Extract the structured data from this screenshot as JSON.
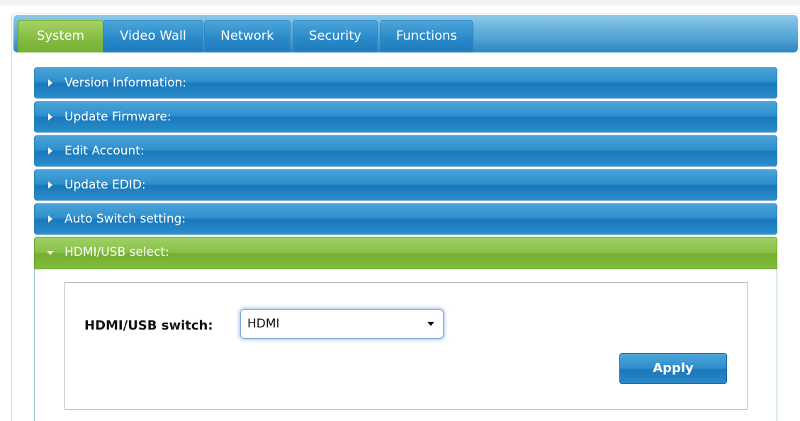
{
  "tabs": [
    {
      "label": "System",
      "active": true
    },
    {
      "label": "Video Wall",
      "active": false
    },
    {
      "label": "Network",
      "active": false
    },
    {
      "label": "Security",
      "active": false
    },
    {
      "label": "Functions",
      "active": false
    }
  ],
  "accordion": [
    {
      "label": "Version Information:",
      "expanded": false
    },
    {
      "label": "Update Firmware:",
      "expanded": false
    },
    {
      "label": "Edit Account:",
      "expanded": false
    },
    {
      "label": "Update EDID:",
      "expanded": false
    },
    {
      "label": "Auto Switch setting:",
      "expanded": false
    },
    {
      "label": "HDMI/USB select:",
      "expanded": true
    }
  ],
  "hdmi_usb_panel": {
    "field_label": "HDMI/USB switch:",
    "selected_value": "HDMI",
    "apply_label": "Apply"
  },
  "icons": {
    "collapsed": "caret-right-icon",
    "expanded": "caret-down-icon",
    "select_arrow": "dropdown-arrow-icon"
  },
  "colors": {
    "accent_blue": "#2a8ac9",
    "active_green": "#86bd43"
  }
}
